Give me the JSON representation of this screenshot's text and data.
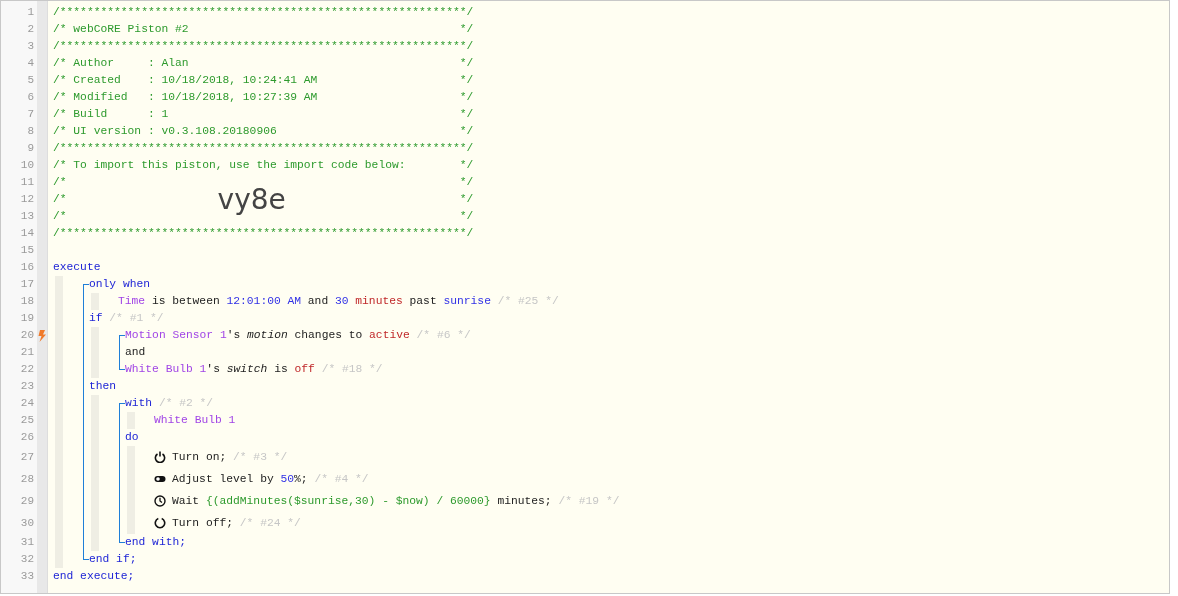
{
  "lines": [
    {
      "number": "1",
      "kind": "plain",
      "flagged": false,
      "segments": [
        {
          "text": "/************************************************************/",
          "kind": "comment"
        }
      ]
    },
    {
      "number": "2",
      "kind": "plain",
      "flagged": false,
      "segments": [
        {
          "text": "/* webCoRE Piston #2",
          "kind": "comment"
        },
        {
          "text": "*/",
          "kind": "comment-end"
        }
      ]
    },
    {
      "number": "3",
      "kind": "plain",
      "flagged": false,
      "segments": [
        {
          "text": "/************************************************************/",
          "kind": "comment"
        }
      ]
    },
    {
      "number": "4",
      "kind": "plain",
      "flagged": false,
      "segments": [
        {
          "text": "/* Author     : Alan",
          "kind": "comment"
        },
        {
          "text": "*/",
          "kind": "comment-end"
        }
      ]
    },
    {
      "number": "5",
      "kind": "plain",
      "flagged": false,
      "segments": [
        {
          "text": "/* Created    : 10/18/2018, 10:24:41 AM",
          "kind": "comment"
        },
        {
          "text": "*/",
          "kind": "comment-end"
        }
      ]
    },
    {
      "number": "6",
      "kind": "plain",
      "flagged": false,
      "segments": [
        {
          "text": "/* Modified   : 10/18/2018, 10:27:39 AM",
          "kind": "comment"
        },
        {
          "text": "*/",
          "kind": "comment-end"
        }
      ]
    },
    {
      "number": "7",
      "kind": "plain",
      "flagged": false,
      "segments": [
        {
          "text": "/* Build      : 1",
          "kind": "comment"
        },
        {
          "text": "*/",
          "kind": "comment-end"
        }
      ]
    },
    {
      "number": "8",
      "kind": "plain",
      "flagged": false,
      "segments": [
        {
          "text": "/* UI version : v0.3.108.20180906",
          "kind": "comment"
        },
        {
          "text": "*/",
          "kind": "comment-end"
        }
      ]
    },
    {
      "number": "9",
      "kind": "plain",
      "flagged": false,
      "segments": [
        {
          "text": "/************************************************************/",
          "kind": "comment"
        }
      ]
    },
    {
      "number": "10",
      "kind": "plain",
      "flagged": false,
      "segments": [
        {
          "text": "/* To import this piston, use the import code below:",
          "kind": "comment"
        },
        {
          "text": "*/",
          "kind": "comment-end"
        }
      ]
    },
    {
      "number": "11",
      "kind": "plain",
      "flagged": false,
      "segments": [
        {
          "text": "/*",
          "kind": "comment"
        },
        {
          "text": "*/",
          "kind": "comment-end"
        }
      ]
    },
    {
      "number": "12",
      "kind": "plain",
      "flagged": false,
      "segments": [
        {
          "text": "/*",
          "kind": "comment"
        },
        {
          "text": "vy8e",
          "kind": "code"
        },
        {
          "text": "*/",
          "kind": "comment-end"
        }
      ]
    },
    {
      "number": "13",
      "kind": "plain",
      "flagged": false,
      "segments": [
        {
          "text": "/*",
          "kind": "comment"
        },
        {
          "text": "*/",
          "kind": "comment-end"
        }
      ]
    },
    {
      "number": "14",
      "kind": "plain",
      "flagged": false,
      "segments": [
        {
          "text": "/************************************************************/",
          "kind": "comment"
        }
      ]
    },
    {
      "number": "15",
      "kind": "plain",
      "flagged": false
    },
    {
      "number": "16",
      "kind": "plain",
      "flagged": false,
      "segments": [
        {
          "text": "execute",
          "kind": "keyword"
        }
      ],
      "bracketed": true,
      "children": [
        {
          "number": "17",
          "kind": "plain",
          "flagged": false,
          "segments": [
            {
              "text": "only when",
              "kind": "keyword"
            }
          ],
          "bracketed": false,
          "children": [
            {
              "number": "18",
              "kind": "plain",
              "flagged": false,
              "segments": [
                {
                  "text": "Time",
                  "kind": "device"
                },
                {
                  "text": " is between ",
                  "kind": "text"
                },
                {
                  "text": "12:01:00 AM",
                  "kind": "operand"
                },
                {
                  "text": " and ",
                  "kind": "text"
                },
                {
                  "text": "30",
                  "kind": "operand"
                },
                {
                  "text": " minutes",
                  "kind": "unit"
                },
                {
                  "text": " past ",
                  "kind": "text"
                },
                {
                  "text": "sunrise",
                  "kind": "operand"
                },
                {
                  "text": " /* #25 */",
                  "kind": "note"
                }
              ]
            }
          ]
        },
        {
          "number": "19",
          "kind": "plain",
          "flagged": false,
          "segments": [
            {
              "text": "if",
              "kind": "keyword"
            },
            {
              "text": " /* #1 */",
              "kind": "note"
            }
          ],
          "bracketed": true,
          "children": [
            {
              "number": "20",
              "kind": "plain",
              "flagged": true,
              "segments": [
                {
                  "text": "Motion Sensor 1",
                  "kind": "device"
                },
                {
                  "text": "'s ",
                  "kind": "text"
                },
                {
                  "text": "motion",
                  "kind": "attribute"
                },
                {
                  "text": " changes to ",
                  "kind": "text"
                },
                {
                  "text": "active",
                  "kind": "state"
                },
                {
                  "text": " /* #6 */",
                  "kind": "note"
                }
              ]
            },
            {
              "number": "21",
              "kind": "plain",
              "flagged": false,
              "segments": [
                {
                  "text": "and",
                  "kind": "text"
                }
              ]
            },
            {
              "number": "22",
              "kind": "plain",
              "flagged": false,
              "segments": [
                {
                  "text": "White Bulb 1",
                  "kind": "device"
                },
                {
                  "text": "'s ",
                  "kind": "text"
                },
                {
                  "text": "switch",
                  "kind": "attribute"
                },
                {
                  "text": " is ",
                  "kind": "text"
                },
                {
                  "text": "off",
                  "kind": "state"
                },
                {
                  "text": " /* #18 */",
                  "kind": "note"
                }
              ]
            }
          ]
        },
        {
          "number": "23",
          "kind": "plain",
          "flagged": false,
          "segments": [
            {
              "text": "then",
              "kind": "keyword"
            }
          ],
          "bracketed": true,
          "children": [
            {
              "number": "24",
              "kind": "plain",
              "flagged": false,
              "segments": [
                {
                  "text": "with",
                  "kind": "keyword"
                },
                {
                  "text": " /* #2 */",
                  "kind": "note"
                }
              ],
              "bracketed": false,
              "children": [
                {
                  "number": "25",
                  "kind": "plain",
                  "flagged": false,
                  "segments": [
                    {
                      "text": "White Bulb 1",
                      "kind": "device"
                    }
                  ]
                }
              ]
            },
            {
              "number": "26",
              "kind": "plain",
              "flagged": false,
              "segments": [
                {
                  "text": "do",
                  "kind": "keyword"
                }
              ],
              "bracketed": false,
              "children": [
                {
                  "number": "27",
                  "kind": "power",
                  "flagged": false,
                  "segments": [
                    {
                      "text": "Turn on; ",
                      "kind": "text"
                    },
                    {
                      "text": "/* #3 */",
                      "kind": "note"
                    }
                  ]
                },
                {
                  "number": "28",
                  "kind": "toggle",
                  "flagged": false,
                  "segments": [
                    {
                      "text": "Adjust level by ",
                      "kind": "text"
                    },
                    {
                      "text": "50",
                      "kind": "operand"
                    },
                    {
                      "text": "%; ",
                      "kind": "text"
                    },
                    {
                      "text": "/* #4 */",
                      "kind": "note"
                    }
                  ]
                },
                {
                  "number": "29",
                  "kind": "clock",
                  "flagged": false,
                  "segments": [
                    {
                      "text": "Wait ",
                      "kind": "text"
                    },
                    {
                      "text": "{(addMinutes($sunrise,30) - $now) / 60000}",
                      "kind": "expression"
                    },
                    {
                      "text": " minutes; ",
                      "kind": "text"
                    },
                    {
                      "text": "/* #19 */",
                      "kind": "note"
                    }
                  ]
                },
                {
                  "number": "30",
                  "kind": "power-off",
                  "flagged": false,
                  "segments": [
                    {
                      "text": "Turn off; ",
                      "kind": "text"
                    },
                    {
                      "text": "/* #24 */",
                      "kind": "note"
                    }
                  ]
                }
              ]
            },
            {
              "number": "31",
              "kind": "plain",
              "flagged": false,
              "segments": [
                {
                  "text": "end with;",
                  "kind": "keyword"
                }
              ]
            }
          ]
        },
        {
          "number": "32",
          "kind": "plain",
          "flagged": false,
          "segments": [
            {
              "text": "end if;",
              "kind": "keyword"
            }
          ]
        }
      ]
    },
    {
      "number": "33",
      "kind": "plain",
      "flagged": false,
      "segments": [
        {
          "text": "end execute;",
          "kind": "keyword"
        }
      ]
    }
  ]
}
